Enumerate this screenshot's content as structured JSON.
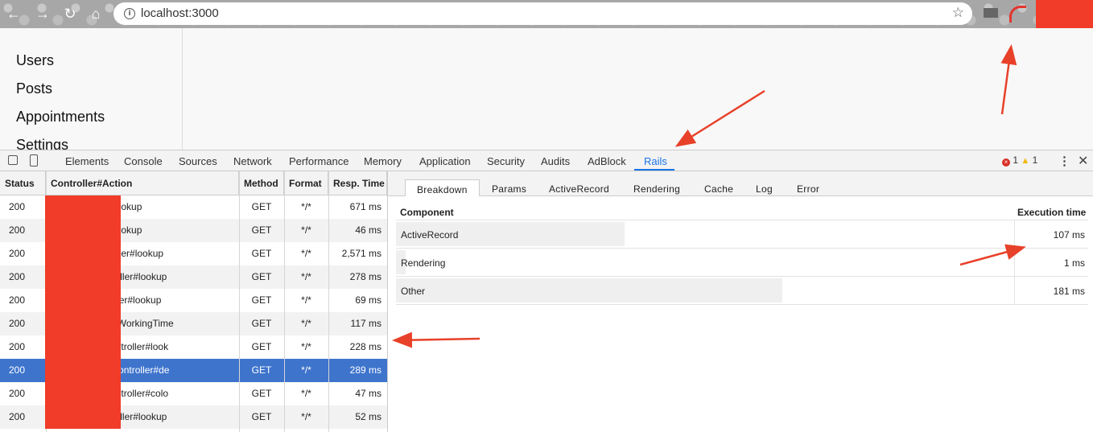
{
  "browser": {
    "url": "localhost:3000",
    "back_icon": "←",
    "forward_icon": "→",
    "reload_icon": "↻",
    "home_icon": "⌂",
    "info_icon": "i",
    "star_icon": "☆"
  },
  "page": {
    "links": [
      "Users",
      "Posts",
      "Appointments",
      "Settings"
    ]
  },
  "devtools": {
    "tabs": [
      "Elements",
      "Console",
      "Sources",
      "Network",
      "Performance",
      "Memory",
      "Application",
      "Security",
      "Audits",
      "AdBlock",
      "Rails"
    ],
    "active_tab": "Rails",
    "error_count": "1",
    "warning_count": "1",
    "error_glyph": "×",
    "warning_glyph": "▲",
    "more_icon": "⋮",
    "close_icon": "✕"
  },
  "requests": {
    "columns": [
      "Status",
      "Controller#Action",
      "Method",
      "Format",
      "Resp. Time"
    ],
    "rows": [
      {
        "status": "200",
        "action": "onsController#lookup",
        "method": "GET",
        "format": "*/*",
        "time": "671 ms"
      },
      {
        "status": "200",
        "action": "onsController#lookup",
        "method": "GET",
        "format": "*/*",
        "time": "46 ms"
      },
      {
        "status": "200",
        "action": "::GroupsController#lookup",
        "method": "GET",
        "format": "*/*",
        "time": "2,571 ms"
      },
      {
        "status": "200",
        "action": "::TrainersController#lookup",
        "method": "GET",
        "format": "*/*",
        "time": "278 ms"
      },
      {
        "status": "200",
        "action": "::ClientsController#lookup",
        "method": "GET",
        "format": "*/*",
        "time": "69 ms"
      },
      {
        "status": "200",
        "action": "hedule::ServiceWorkingTime",
        "method": "GET",
        "format": "*/*",
        "time": "117 ms"
      },
      {
        "status": "200",
        "action": "es::ServicesController#look",
        "method": "GET",
        "format": "*/*",
        "time": "228 ms"
      },
      {
        "status": "200",
        "action": "lule::ScheduleController#de",
        "method": "GET",
        "format": "*/*",
        "time": "289 ms"
      },
      {
        "status": "200",
        "action": "es::ServicesController#colo",
        "method": "GET",
        "format": "*/*",
        "time": "47 ms"
      },
      {
        "status": "200",
        "action": "::TrainersController#lookup",
        "method": "GET",
        "format": "*/*",
        "time": "52 ms"
      }
    ],
    "selected_index": 7
  },
  "detail": {
    "tabs": [
      "Breakdown",
      "Params",
      "ActiveRecord",
      "Rendering",
      "Cache",
      "Log",
      "Error"
    ],
    "active_tab": "Breakdown",
    "component_header": "Component",
    "time_header": "Execution time",
    "breakdown": [
      {
        "component": "ActiveRecord",
        "time": "107 ms",
        "share": 0.37
      },
      {
        "component": "Rendering",
        "time": "1 ms",
        "share": 0.015
      },
      {
        "component": "Other",
        "time": "181 ms",
        "share": 0.625
      }
    ]
  },
  "colors": {
    "accent": "#1a73e8",
    "selected_row": "#3e74cc",
    "annotation": "#e8412a",
    "redaction": "#f03c28"
  }
}
